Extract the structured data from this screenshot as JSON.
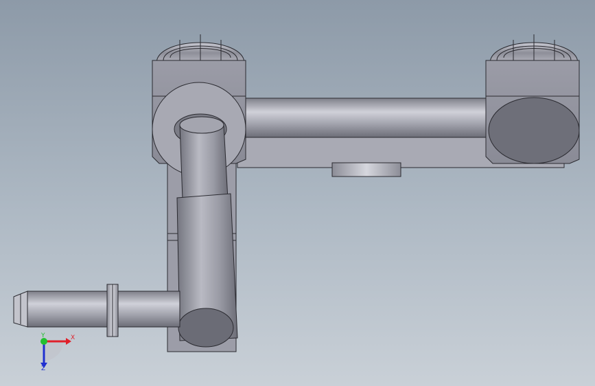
{
  "viewport": {
    "background_top": "#8d9aa8",
    "background_bottom": "#c9d0d7"
  },
  "model": {
    "part_color": "#9fa0ab",
    "edge_color": "#2a2a30",
    "face_dark": "#6d6e78",
    "face_light": "#c8c9d2"
  },
  "triad": {
    "x_label": "X",
    "y_label": "Y",
    "z_label": "Z",
    "x_color": "#e0202a",
    "y_color": "#22c030",
    "z_color": "#2030d0"
  }
}
